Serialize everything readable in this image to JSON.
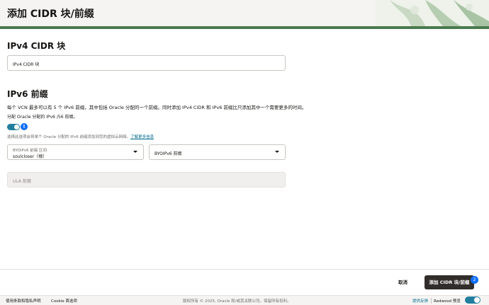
{
  "header": {
    "title": "添加 CIDR 块/前缀"
  },
  "ipv4": {
    "heading": "IPv4 CIDR 块",
    "input_value": "IPv4 CIDR 块"
  },
  "ipv6": {
    "heading": "IPv6 前缀",
    "description": "每个 VCN 最多可以有 5 个 IPv6 前缀，其中包括 Oracle 分配的一个前缀。同时添加 IPv4 CIDR 和 IPv6 前缀比只添加其中一个需要更多的时间。",
    "toggle_label": "分配 Oracle 分配的 IPv6 /56 前缀。",
    "toggle_info": "!",
    "help_text": "选择此选项会将单个 Oracle 分配的 IPv6 前缀添加到您的虚拟云网络。",
    "help_link": "了解更多信息",
    "byoip_range_label": "BYOIPv6 前缀 区间",
    "byoip_range_value": "soulcloser（根）",
    "byoip_prefix_value": "BYOIPv6 前缀",
    "ula_value": "ULA 前缀"
  },
  "actions": {
    "cancel": "取消",
    "submit": "添加 CIDR 块/前缀",
    "badge_count": "2"
  },
  "footer": {
    "terms": "使用条款和隐私声明",
    "cookie": "Cookie 首选项",
    "copyright": "版权所有 © 2025, Oracle 和/或其关联公司。保留所有权利。",
    "feedback": "提供反馈",
    "redwood": "Redwood 预览"
  },
  "colors": {
    "accent": "#227e9e",
    "primary_button": "#312d2a",
    "header_band": "#4a7a4e",
    "badge": "#0d6efd"
  }
}
